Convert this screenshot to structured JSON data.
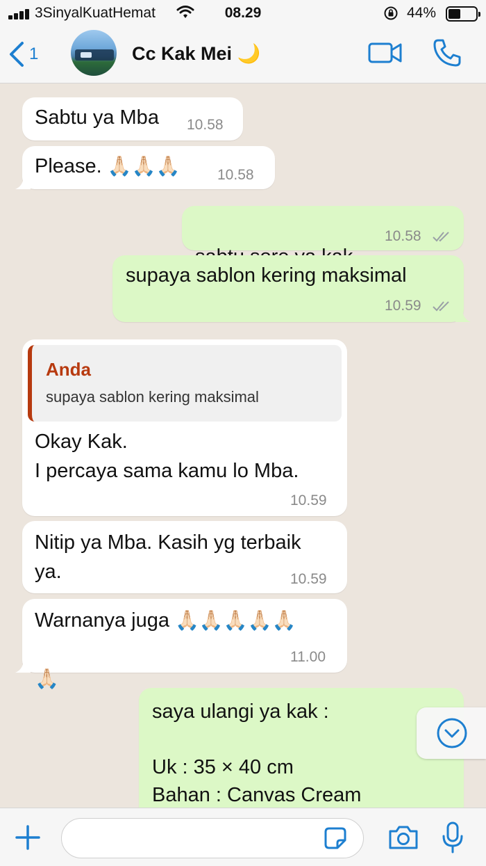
{
  "status_bar": {
    "carrier": "3SinyalKuatHemat",
    "time": "08.29",
    "battery_percent": "44%",
    "battery_level": 0.44
  },
  "header": {
    "back_count": "1",
    "contact_name": "Cc Kak Mei 🌙"
  },
  "messages": [
    {
      "direction": "in",
      "text": "Sabtu ya Mba",
      "time": "10.58"
    },
    {
      "direction": "in",
      "text": "Please.",
      "emoji": "🙏🏻🙏🏻🙏🏻",
      "time": "10.58"
    },
    {
      "direction": "out",
      "text": "sabtu sore ya kak",
      "underlined": "sabtu sore",
      "rest": " ya kak",
      "time": "10.58",
      "status": "read"
    },
    {
      "direction": "out",
      "text": "supaya sablon kering maksimal",
      "time": "10.59",
      "status": "read"
    },
    {
      "direction": "in",
      "quote_author": "Anda",
      "quote_text": "supaya sablon kering maksimal",
      "text": "Okay Kak.\nI percaya sama kamu lo Mba.",
      "time": "10.59"
    },
    {
      "direction": "in",
      "text": "Nitip ya Mba. Kasih yg terbaik\nya.",
      "time": "10.59"
    },
    {
      "direction": "in",
      "text": "Warnanya juga",
      "emoji": "🙏🏻🙏🏻🙏🏻🙏🏻🙏🏻",
      "emoji2": "🙏🏻",
      "time": "11.00"
    },
    {
      "direction": "out",
      "text": "saya ulangi ya kak :\n\nUk : 35 × 40 cm\nBahan  : Canvas Cream"
    }
  ],
  "composer": {
    "placeholder": ""
  },
  "icons": [
    "signal-icon",
    "wifi-icon",
    "orientation-lock-icon",
    "battery-icon",
    "back-chevron-icon",
    "video-call-icon",
    "phone-icon",
    "double-check-icon",
    "chevron-down-icon",
    "plus-icon",
    "sticker-icon",
    "camera-icon",
    "microphone-icon"
  ],
  "colors": {
    "accent": "#1d7fd0",
    "outgoing_bubble": "#dcf8c6",
    "incoming_bubble": "#ffffff",
    "chat_background": "#ece5dd",
    "quote_author": "#b73a0f",
    "read_ticks": "#9aa0a6"
  }
}
